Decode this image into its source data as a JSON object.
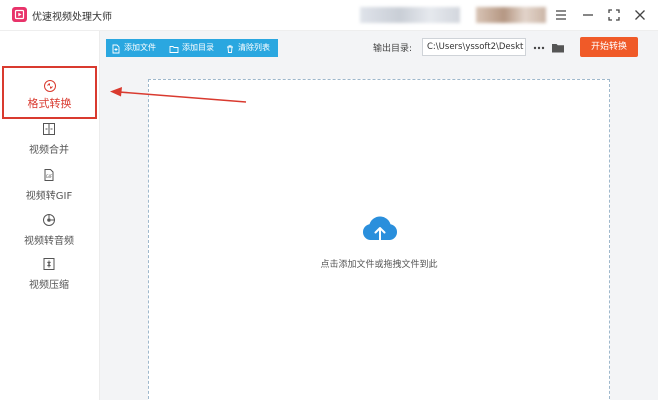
{
  "app": {
    "title": "优速视频处理大师"
  },
  "window_controls": [
    "menu-icon",
    "minimize-icon",
    "maximize-icon",
    "close-icon"
  ],
  "sidebar": {
    "items": [
      {
        "label": "格式转换",
        "icon": "format-convert-icon",
        "active": true
      },
      {
        "label": "视频合并",
        "icon": "merge-icon",
        "active": false
      },
      {
        "label": "视频转GIF",
        "icon": "gif-icon",
        "active": false
      },
      {
        "label": "视频转音频",
        "icon": "audio-icon",
        "active": false
      },
      {
        "label": "视频压缩",
        "icon": "compress-icon",
        "active": false
      }
    ]
  },
  "toolbar": {
    "add_file": "添加文件",
    "add_dir": "添加目录",
    "clear_list": "清除列表",
    "output_label": "输出目录:",
    "output_path": "C:\\Users\\yssoft2\\Deskt",
    "start": "开始转换"
  },
  "main": {
    "drop_hint": "点击添加文件或拖拽文件到此"
  },
  "colors": {
    "accent_blue": "#2aa7e0",
    "start_orange": "#f05a28",
    "highlight_red": "#d93a2f",
    "logo_pink": "#e8336a"
  }
}
